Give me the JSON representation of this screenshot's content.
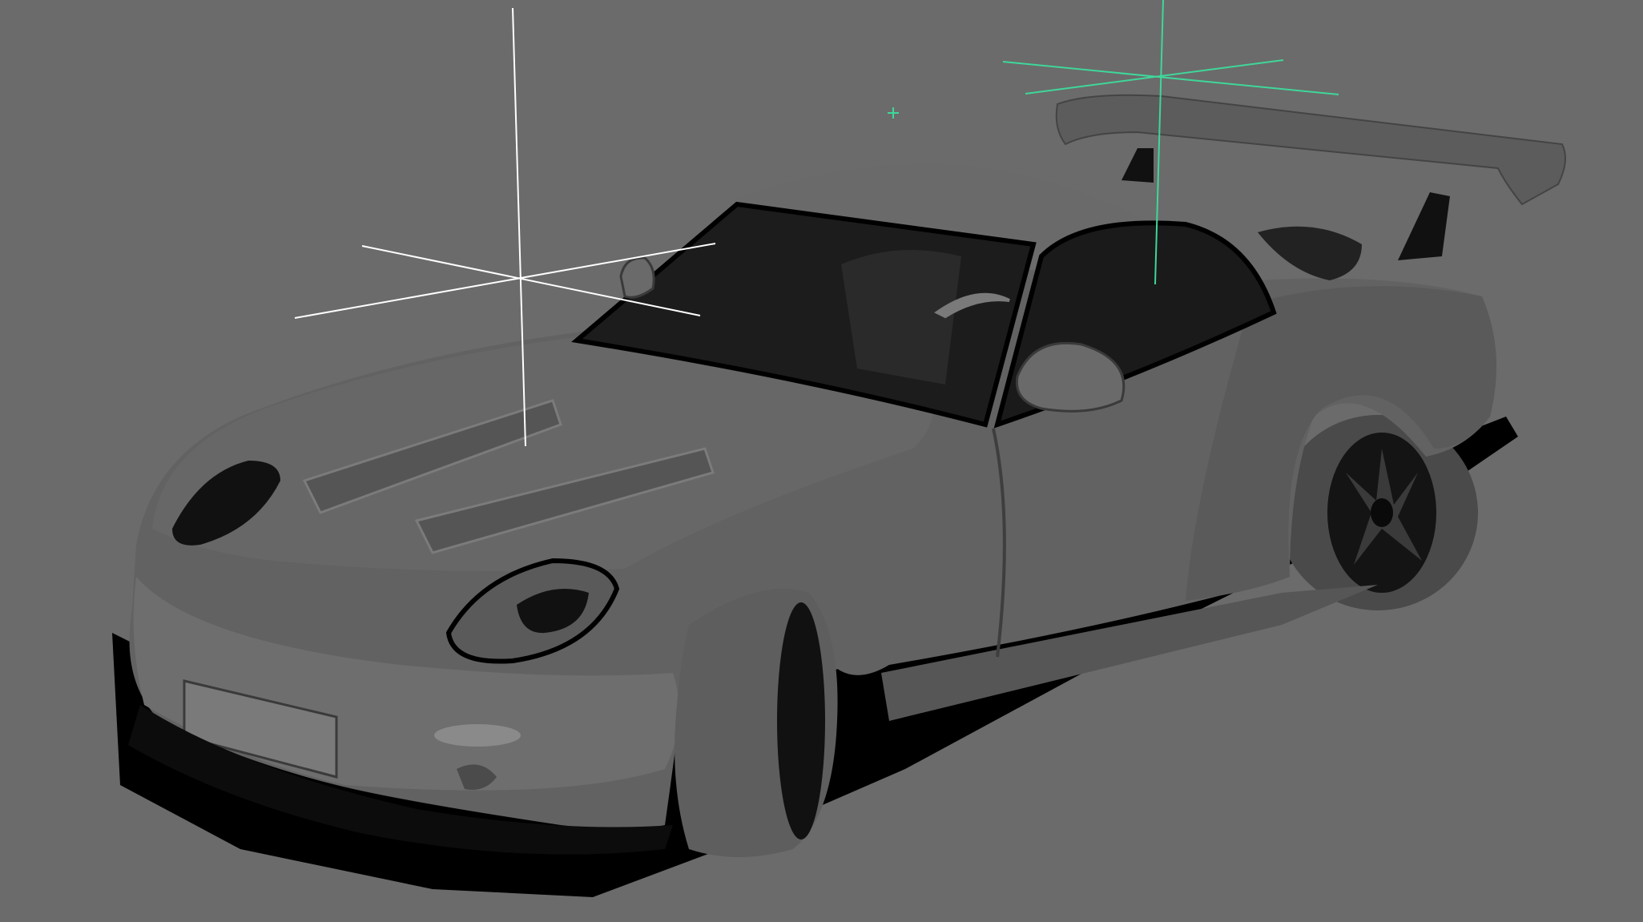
{
  "viewport": {
    "background": "#6b6b6b",
    "model": "sports-car-mesh",
    "shading": "smooth-shaded",
    "locators": [
      {
        "name": "white-locator",
        "color": "#ffffff",
        "state": "unselected"
      },
      {
        "name": "green-locator",
        "color": "#3fd79a",
        "state": "selected"
      },
      {
        "name": "green-marker",
        "color": "#3fd79a",
        "state": "pivot"
      }
    ]
  },
  "colors": {
    "body": "#5f5f5f",
    "body_dark": "#4a4a4a",
    "body_light": "#727272",
    "glass": "#1b1b1b",
    "interior": "#2a2a2a",
    "tire": "#3a3a3a",
    "rim": "#101010",
    "shadow": "#000000"
  }
}
